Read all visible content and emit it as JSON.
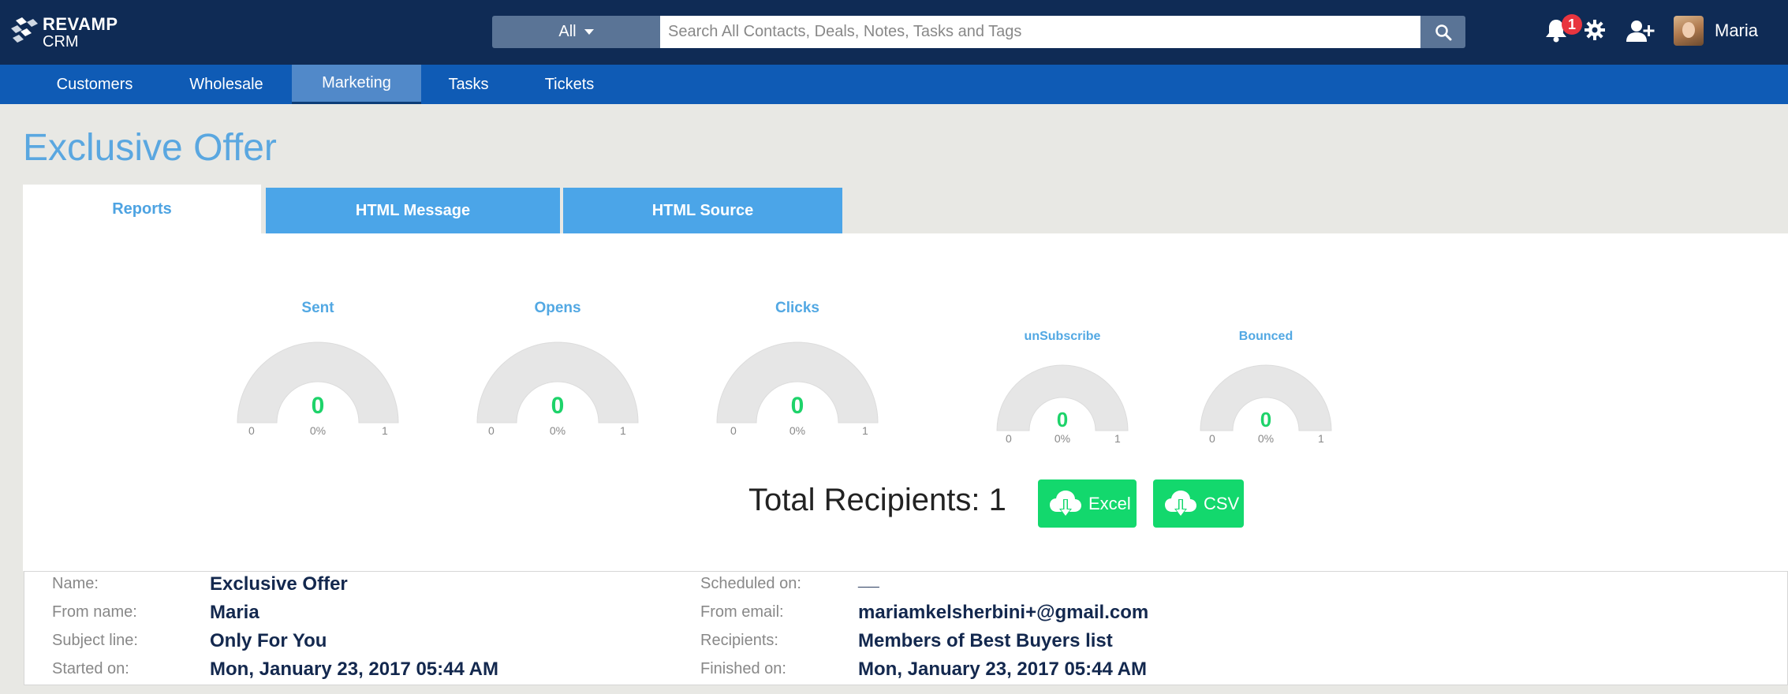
{
  "header": {
    "logo_line1": "REVAMP",
    "logo_line2": "CRM",
    "search_scope": "All",
    "search_placeholder": "Search All Contacts, Deals, Notes, Tasks and Tags",
    "notification_count": "1",
    "user_name": "Maria",
    "icons": [
      "search-icon",
      "bell-icon",
      "gear-icon",
      "add-user-icon"
    ]
  },
  "nav": {
    "items": [
      {
        "label": "Customers"
      },
      {
        "label": "Wholesale"
      },
      {
        "label": "Marketing",
        "active": true
      },
      {
        "label": "Tasks"
      },
      {
        "label": "Tickets"
      }
    ]
  },
  "page": {
    "title": "Exclusive Offer"
  },
  "tabs": [
    {
      "label": "Reports",
      "active": true
    },
    {
      "label": "HTML Message"
    },
    {
      "label": "HTML Source"
    }
  ],
  "gauges": [
    {
      "title": "Sent",
      "value": "0",
      "percent": "0%",
      "min": "0",
      "max": "1"
    },
    {
      "title": "Opens",
      "value": "0",
      "percent": "0%",
      "min": "0",
      "max": "1"
    },
    {
      "title": "Clicks",
      "value": "0",
      "percent": "0%",
      "min": "0",
      "max": "1"
    },
    {
      "title": "unSubscribe",
      "value": "0",
      "percent": "0%",
      "min": "0",
      "max": "1"
    },
    {
      "title": "Bounced",
      "value": "0",
      "percent": "0%",
      "min": "0",
      "max": "1"
    }
  ],
  "summary": {
    "total_recipients": "Total Recipients: 1",
    "excel_label": "Excel",
    "csv_label": "CSV"
  },
  "details": {
    "name_label": "Name:",
    "name_value": "Exclusive Offer",
    "from_name_label": "From name:",
    "from_name_value": "Maria",
    "subject_label": "Subject line:",
    "subject_value": "Only For You",
    "started_label": "Started on:",
    "started_value": "Mon, January 23, 2017 05:44 AM",
    "scheduled_label": "Scheduled on:",
    "scheduled_value": "__",
    "from_email_label": "From email:",
    "from_email_value": "mariamkelsherbini+@gmail.com",
    "recipients_label": "Recipients:",
    "recipients_value": "Members of Best Buyers list",
    "finished_label": "Finished on:",
    "finished_value": "Mon, January 23, 2017 05:44 AM"
  },
  "colors": {
    "header_bg": "#0f2b55",
    "nav_bg": "#0f5bb5",
    "accent_blue": "#4ba5e8",
    "gauge_value_green": "#1ed36a",
    "download_green": "#13d86d",
    "badge_red": "#e8353f"
  }
}
